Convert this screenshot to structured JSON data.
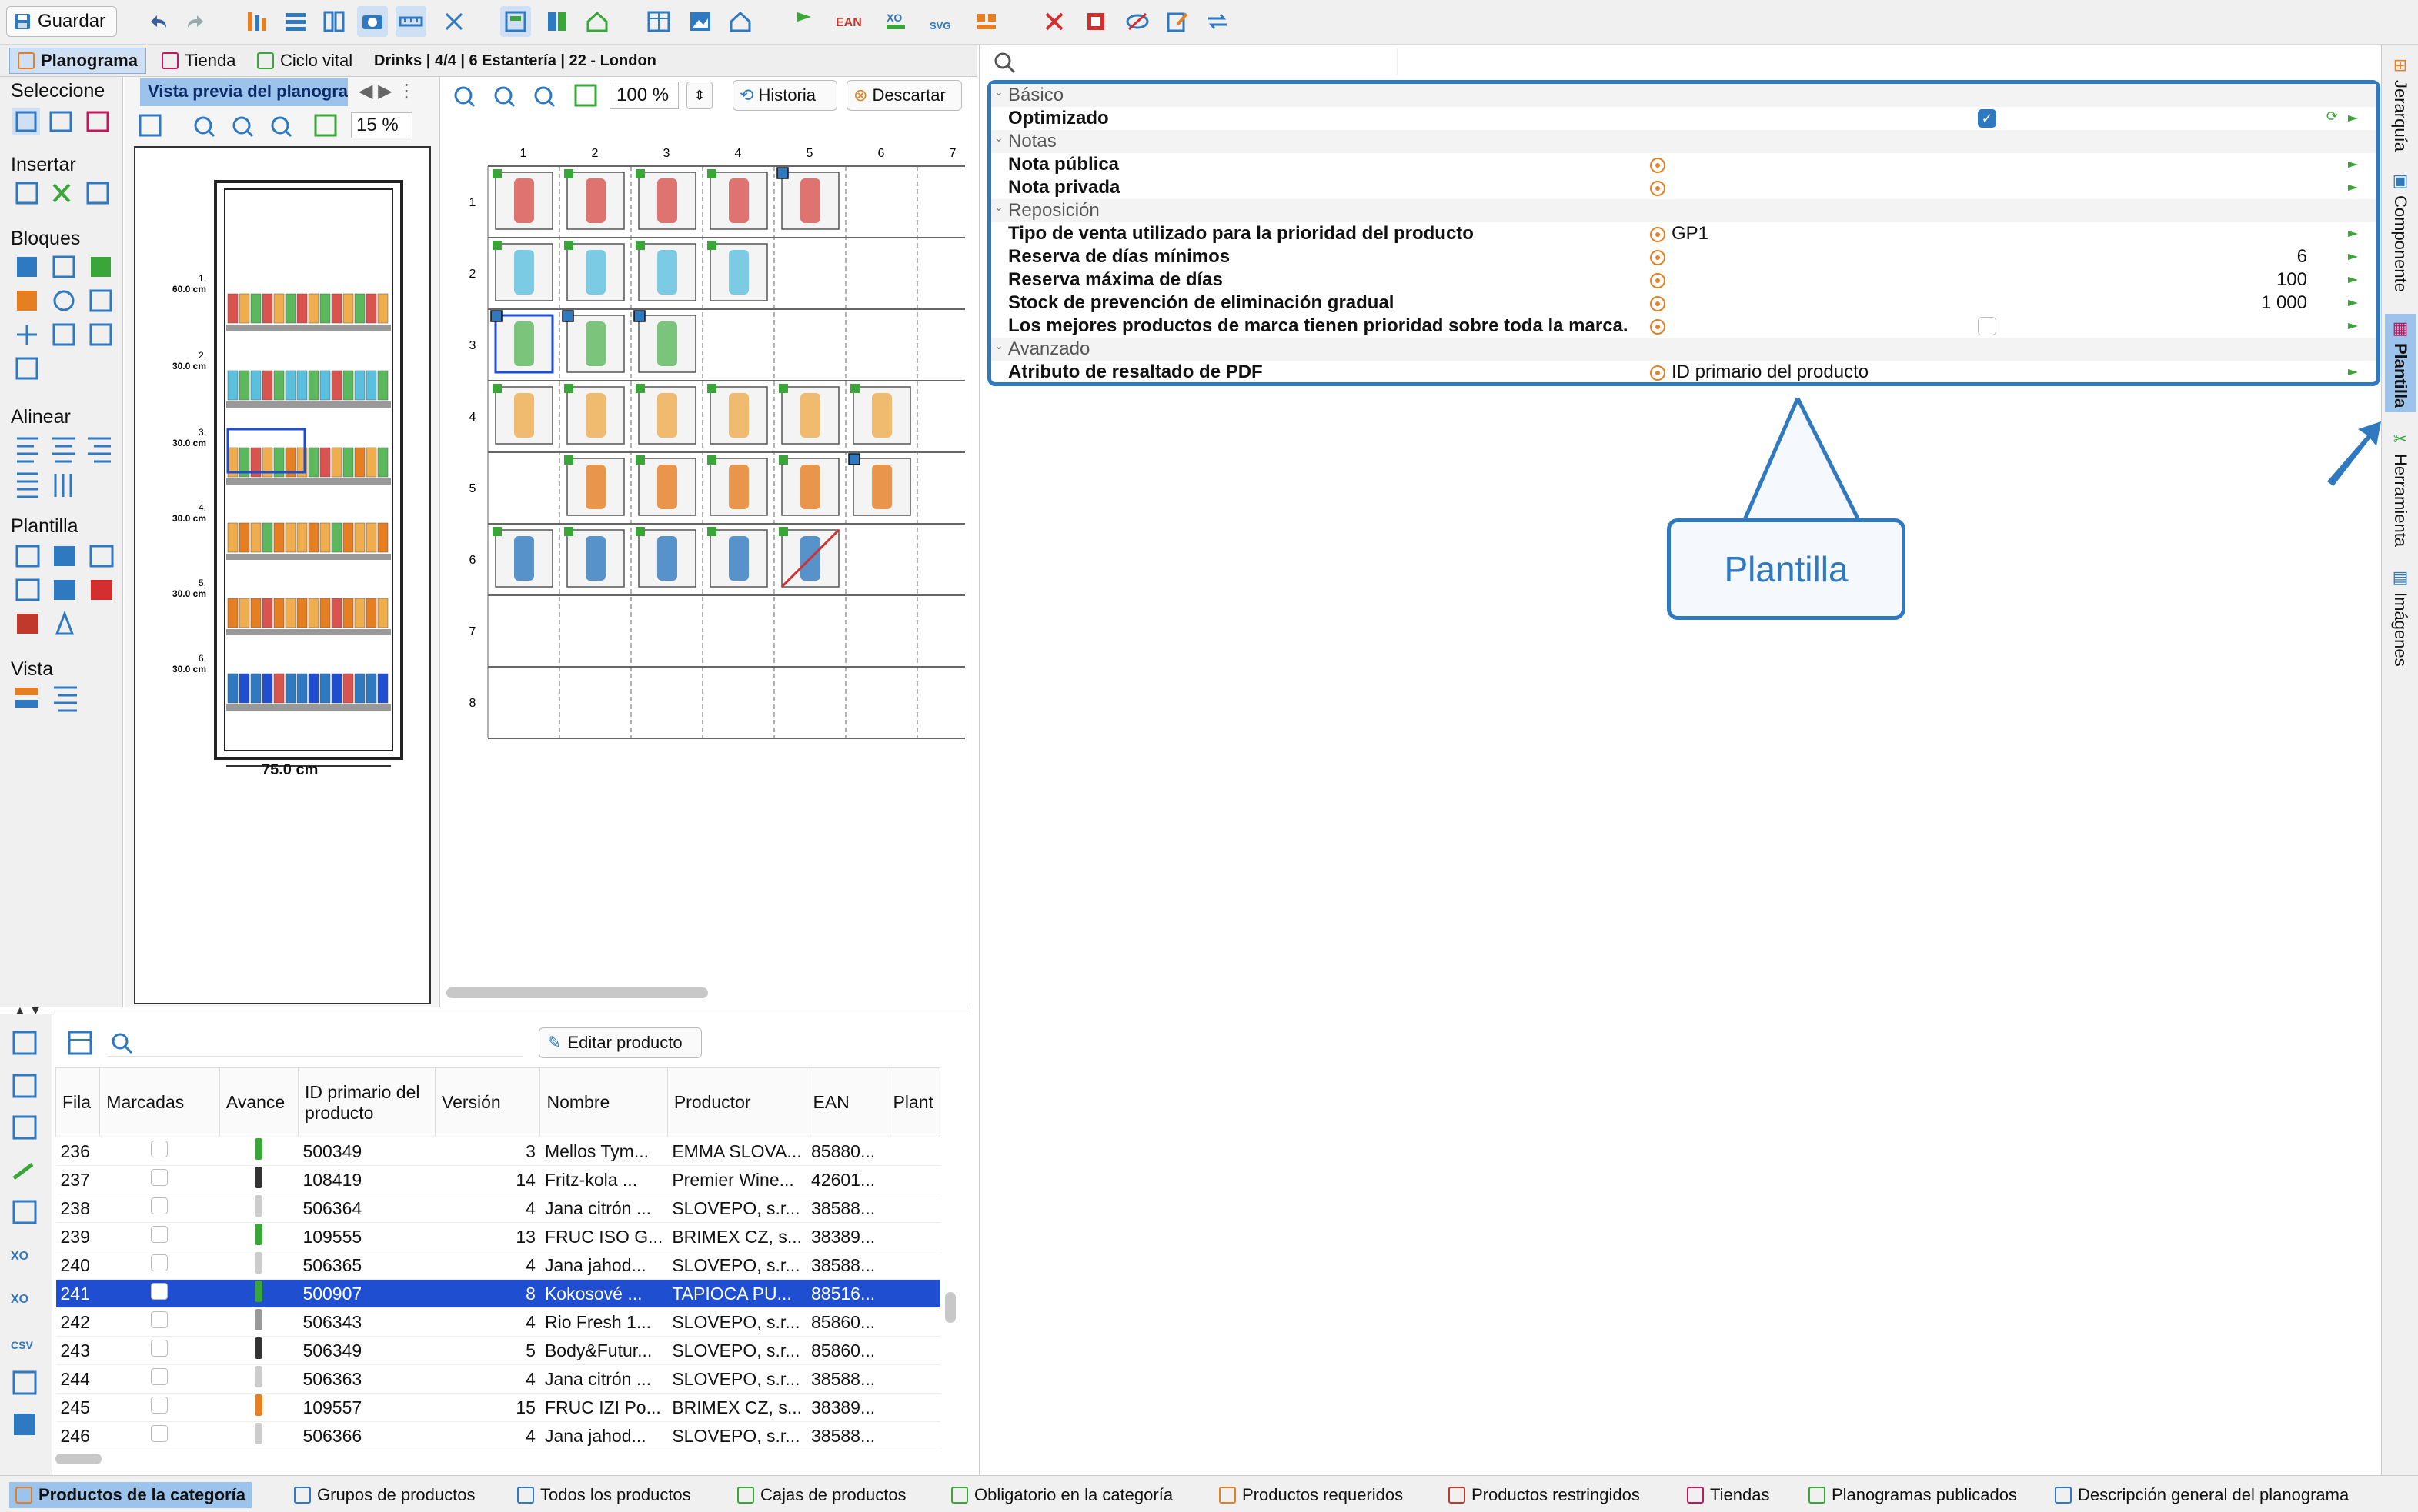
{
  "toolbar": {
    "save_label": "Guardar"
  },
  "tabs": [
    {
      "label": "Planograma"
    },
    {
      "label": "Tienda"
    },
    {
      "label": "Ciclo vital"
    }
  ],
  "breadcrumb": "Drinks | 4/4 | 6 Estantería | 22 - London",
  "palette": {
    "groups": [
      "Seleccione",
      "Insertar",
      "Bloques",
      "Alinear",
      "Plantilla",
      "Vista"
    ]
  },
  "preview": {
    "title": "Vista previa del planograma",
    "zoom": "15 %",
    "width_label": "75.0 cm",
    "shelf_labels": [
      "1.\n60.0 cm",
      "2.\n30.0 cm",
      "3.\n30.0 cm",
      "4.\n30.0 cm",
      "5.\n30.0 cm",
      "6.\n30.0 cm"
    ]
  },
  "planogram": {
    "zoom": "100 %",
    "history_label": "Historia",
    "discard_label": "Descartar",
    "columns": [
      "1",
      "2",
      "3",
      "4",
      "5",
      "6",
      "7"
    ],
    "rows": [
      "1",
      "2",
      "3",
      "4",
      "5",
      "6",
      "7",
      "8"
    ]
  },
  "properties": {
    "rows": [
      {
        "type": "group",
        "label": "Básico"
      },
      {
        "type": "prop",
        "label": "Optimizado",
        "kind": "checkbox",
        "checked": true
      },
      {
        "type": "group",
        "label": "Notas"
      },
      {
        "type": "prop",
        "label": "Nota pública",
        "value": ""
      },
      {
        "type": "prop",
        "label": "Nota privada",
        "value": ""
      },
      {
        "type": "group",
        "label": "Reposición"
      },
      {
        "type": "prop",
        "label": "Tipo de venta utilizado para la prioridad del producto",
        "value": "GP1"
      },
      {
        "type": "prop",
        "label": "Reserva de días mínimos",
        "num": "6"
      },
      {
        "type": "prop",
        "label": "Reserva máxima de días",
        "num": "100"
      },
      {
        "type": "prop",
        "label": "Stock de prevención de eliminación gradual",
        "num": "1 000"
      },
      {
        "type": "prop",
        "label": "Los mejores productos de marca tienen prioridad sobre toda la marca.",
        "kind": "checkbox",
        "checked": false
      },
      {
        "type": "group",
        "label": "Avanzado"
      },
      {
        "type": "prop",
        "label": "Atributo de resaltado de PDF",
        "value": "ID primario del producto"
      }
    ]
  },
  "callout": "Plantilla",
  "sidetabs": [
    "Jerarquía",
    "Componente",
    "Plantilla",
    "Herramienta",
    "Imágenes"
  ],
  "bottom": {
    "edit_label": "Editar producto",
    "headers": [
      "Fila",
      "Marcadas",
      "Avance",
      "ID primario del producto",
      "Versión",
      "Nombre",
      "Productor",
      "EAN",
      "Plant"
    ],
    "rows": [
      [
        "236",
        "",
        "",
        "500349",
        "3",
        "Mellos Tym...",
        "EMMA SLOVA...",
        "85880..."
      ],
      [
        "237",
        "",
        "",
        "108419",
        "14",
        "Fritz-kola ...",
        "Premier Wine...",
        "42601..."
      ],
      [
        "238",
        "",
        "",
        "506364",
        "4",
        "Jana citrón ...",
        "SLOVEPO, s.r...",
        "38588..."
      ],
      [
        "239",
        "",
        "",
        "109555",
        "13",
        "FRUC ISO G...",
        "BRIMEX CZ, s...",
        "38389..."
      ],
      [
        "240",
        "",
        "",
        "506365",
        "4",
        "Jana jahod...",
        "SLOVEPO, s.r...",
        "38588..."
      ],
      [
        "241",
        "",
        "",
        "500907",
        "8",
        "Kokosové ...",
        "TAPIOCA PU...",
        "88516..."
      ],
      [
        "242",
        "",
        "",
        "506343",
        "4",
        "Rio Fresh 1...",
        "SLOVEPO, s.r...",
        "85860..."
      ],
      [
        "243",
        "",
        "",
        "506349",
        "5",
        "Body&Futur...",
        "SLOVEPO, s.r...",
        "85860..."
      ],
      [
        "244",
        "",
        "",
        "506363",
        "4",
        "Jana citrón ...",
        "SLOVEPO, s.r...",
        "38588..."
      ],
      [
        "245",
        "",
        "",
        "109557",
        "15",
        "FRUC IZI Po...",
        "BRIMEX CZ, s...",
        "38389..."
      ],
      [
        "246",
        "",
        "",
        "506366",
        "4",
        "Jana jahod...",
        "SLOVEPO, s.r...",
        "38588..."
      ]
    ],
    "selected_row": "241"
  },
  "bottom_tabs": [
    "Productos de la categoría",
    "Grupos de productos",
    "Todos los productos",
    "Cajas de productos",
    "Obligatorio en la categoría",
    "Productos requeridos",
    "Productos restringidos",
    "Tiendas",
    "Planogramas publicados",
    "Descripción general del planograma"
  ],
  "colors": {
    "accent": "#2f79c0",
    "selection": "#1f4fd0",
    "tab_active": "#9cc3ec",
    "marker": "#3aa63a",
    "close": "#d32f2f"
  }
}
